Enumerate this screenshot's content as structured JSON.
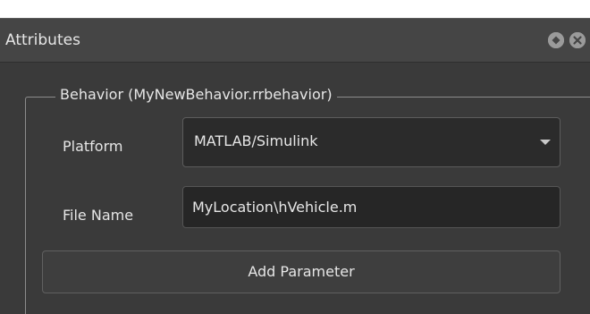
{
  "panel": {
    "title": "Attributes",
    "icons": [
      "float-icon",
      "close-icon"
    ]
  },
  "group": {
    "title": "Behavior (MyNewBehavior.rrbehavior)"
  },
  "platform": {
    "label": "Platform",
    "value": "MATLAB/Simulink"
  },
  "file_name": {
    "label": "File Name",
    "value": "MyLocation\\hVehicle.m"
  },
  "add_parameter": {
    "label": "Add Parameter"
  },
  "colors": {
    "titlebar": "#454545",
    "background": "#3a3a3a",
    "text": "#e6e6e6"
  }
}
